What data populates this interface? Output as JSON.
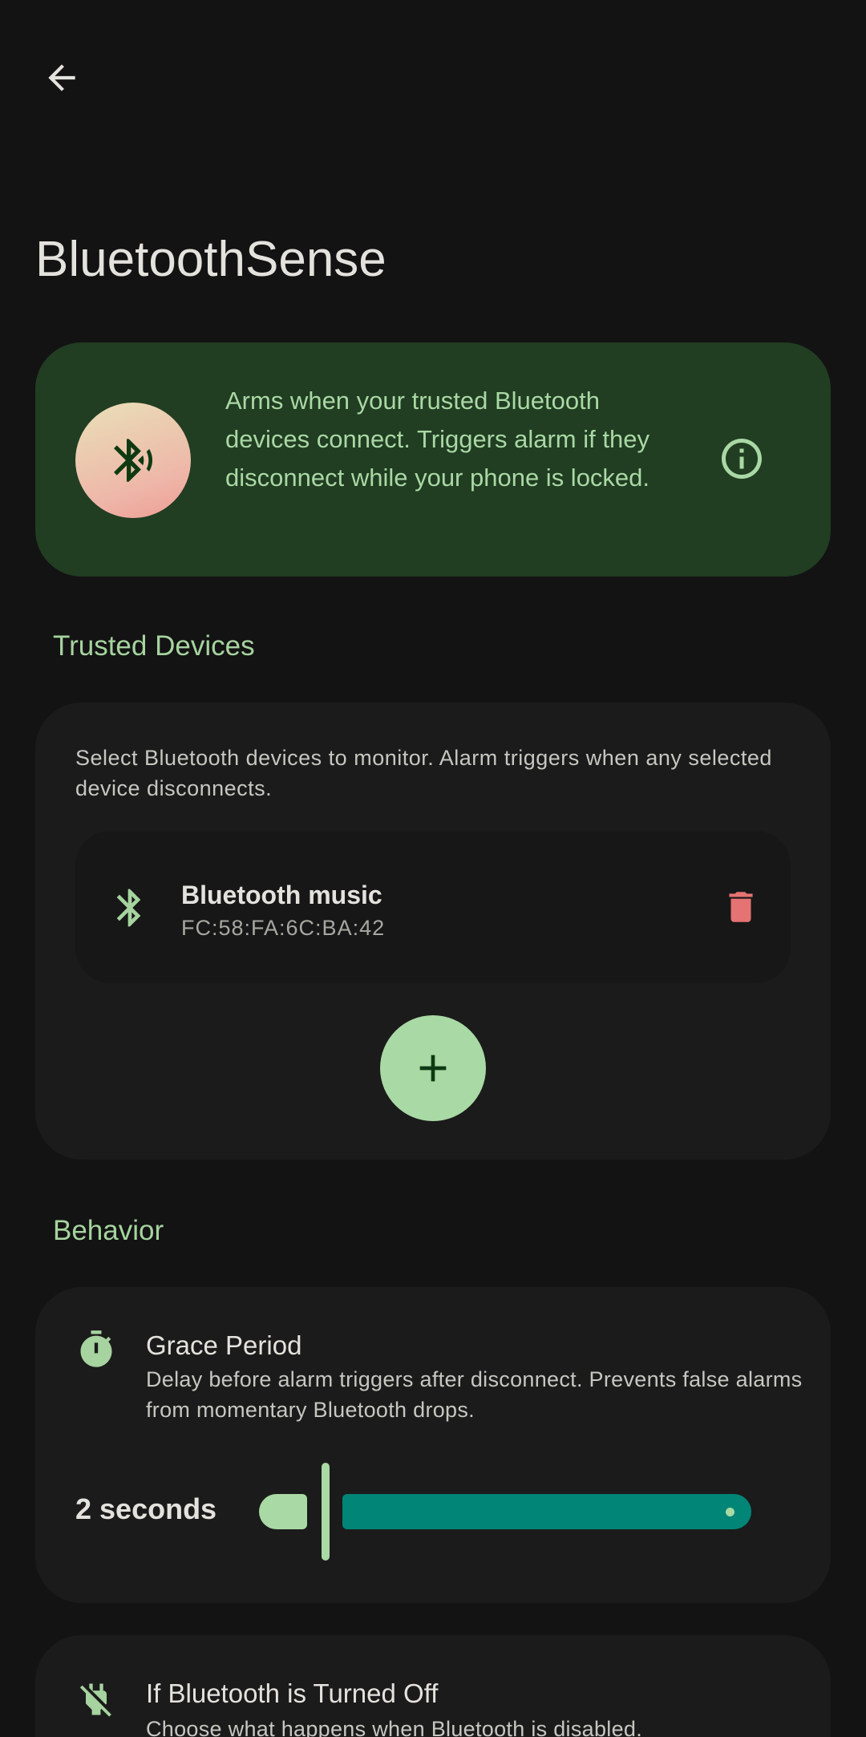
{
  "header": {
    "back_icon": "arrow-back-icon",
    "title": "BluetoothSense"
  },
  "hero": {
    "icon": "bluetooth-searching-icon",
    "description": "Arms when your trusted Bluetooth devices connect. Triggers alarm if they disconnect while your phone is locked.",
    "info_icon": "info-icon",
    "colors": {
      "background": "#213d22",
      "text": "#a9d8a4"
    }
  },
  "trusted_devices": {
    "section_title": "Trusted Devices",
    "description": "Select Bluetooth devices to monitor. Alarm triggers when any selected device disconnects.",
    "devices": [
      {
        "icon": "bluetooth-icon",
        "name": "Bluetooth music",
        "address": "FC:58:FA:6C:BA:42",
        "delete_icon": "trash-icon"
      }
    ],
    "add_icon": "plus-icon"
  },
  "behavior": {
    "section_title": "Behavior",
    "grace_period": {
      "icon": "timer-icon",
      "title": "Grace Period",
      "description": "Delay before alarm triggers after disconnect. Prevents false alarms from momentary Bluetooth drops.",
      "value_label": "2 seconds",
      "value": 2
    },
    "bluetooth_off": {
      "icon": "power-off-icon",
      "title": "If Bluetooth is Turned Off",
      "description": "Choose what happens when Bluetooth is disabled."
    }
  },
  "colors": {
    "background": "#131313",
    "card": "#1b1b1b",
    "accent": "#a9d9a4",
    "slider_track": "#008577",
    "danger": "#e57373"
  }
}
